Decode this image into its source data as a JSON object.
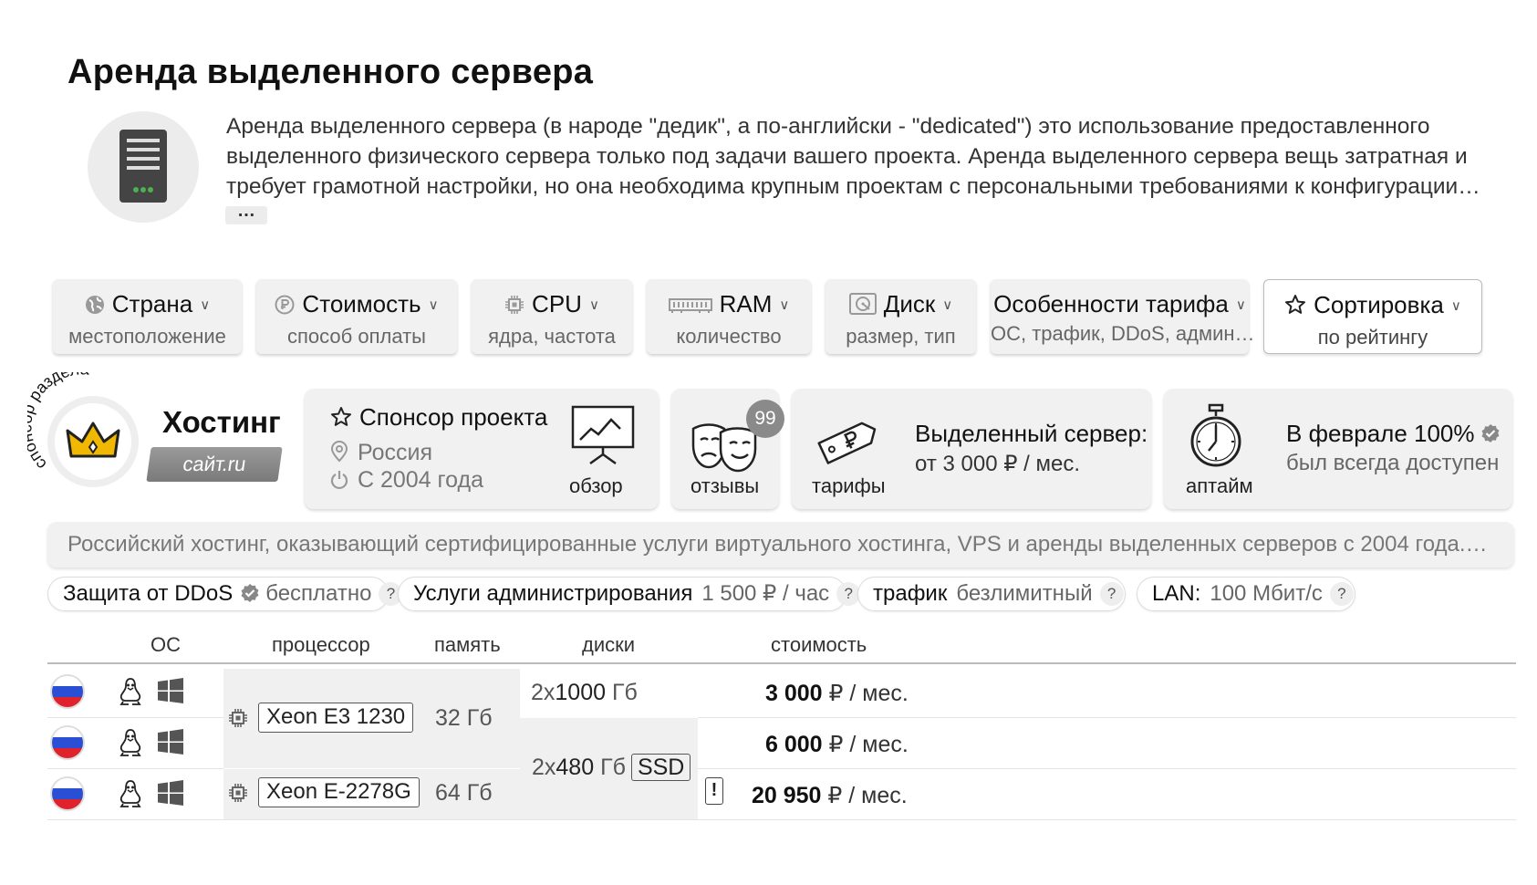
{
  "page": {
    "title": "Аренда выделенного сервера",
    "intro": "Аренда выделенного сервера (в народе \"дедик\", а по-английски - \"dedicated\") это использование предоставленного выделенного физического сервера только под задачи вашего проекта. Аренда выделенного сервера вещь затратная и требует грамотной настройки, но она необходима крупным проектам с персональными требованиями к конфигурации…",
    "more": "…"
  },
  "filters": [
    {
      "title": "Страна",
      "sub": "местоположение",
      "icon": "globe-icon"
    },
    {
      "title": "Стоимость",
      "sub": "способ оплаты",
      "icon": "ruble-icon"
    },
    {
      "title": "CPU",
      "sub": "ядра, частота",
      "icon": "chip-icon"
    },
    {
      "title": "RAM",
      "sub": "количество",
      "icon": "ram-icon"
    },
    {
      "title": "Диск",
      "sub": "размер, тип",
      "icon": "disk-icon"
    },
    {
      "title": "Особенности тарифа",
      "sub": "ОС, трафик, DDoS, админ…",
      "icon": ""
    },
    {
      "title": "Сортировка",
      "sub": "по рейтингу",
      "icon": "star-icon"
    }
  ],
  "provider": {
    "sponsor_ring": "спонсор раздела",
    "name": "Хостинг",
    "site": "сайт.ru",
    "sponsor_title": "Спонсор проекта",
    "country": "Россия",
    "since": "С 2004 года",
    "overview_label": "обзор",
    "reviews_count": "99",
    "reviews_label": "отзывы",
    "tariffs_label": "тарифы",
    "dedicated_title": "Выделенный сервер:",
    "dedicated_price": "от 3 000 ₽ / мес.",
    "uptime_label": "аптайм",
    "uptime_title": "В феврале 100%",
    "uptime_sub": "был всегда доступен",
    "description": "Российский хостинг, оказывающий сертифицированные услуги виртуального хостинга, VPS и аренды выделенных серверов с 2004 года.…"
  },
  "tags": [
    {
      "name": "Защита от DDoS",
      "value": "бесплатно"
    },
    {
      "name": "Услуги администрирования",
      "value": "1 500 ₽ / час"
    },
    {
      "name": "трафик",
      "value": "безлимитный"
    },
    {
      "name": "LAN:",
      "value": "100 Мбит/с"
    }
  ],
  "table": {
    "headers": {
      "os": "ОС",
      "cpu": "процессор",
      "ram": "память",
      "disk": "диски",
      "price": "стоимость"
    },
    "cpus": [
      "Xeon E3 1230",
      "Xeon E-2278G"
    ],
    "mems": [
      "32 Гб",
      "64 Гб"
    ],
    "disk1": {
      "count": "2x",
      "size": "1000",
      "unit": "Гб"
    },
    "disk2": {
      "count": "2x",
      "size": "480",
      "unit": "Гб",
      "type": "SSD"
    },
    "prices": [
      {
        "amount": "3 000",
        "unit": "₽ / мес."
      },
      {
        "amount": "6 000",
        "unit": "₽ / мес."
      },
      {
        "amount": "20 950",
        "unit": "₽ / мес."
      }
    ],
    "warn": "!"
  },
  "colors": {
    "flag_white": "#ffffff",
    "flag_blue": "#2a4fd4",
    "flag_red": "#e0232b",
    "crown": "#f0b800"
  }
}
